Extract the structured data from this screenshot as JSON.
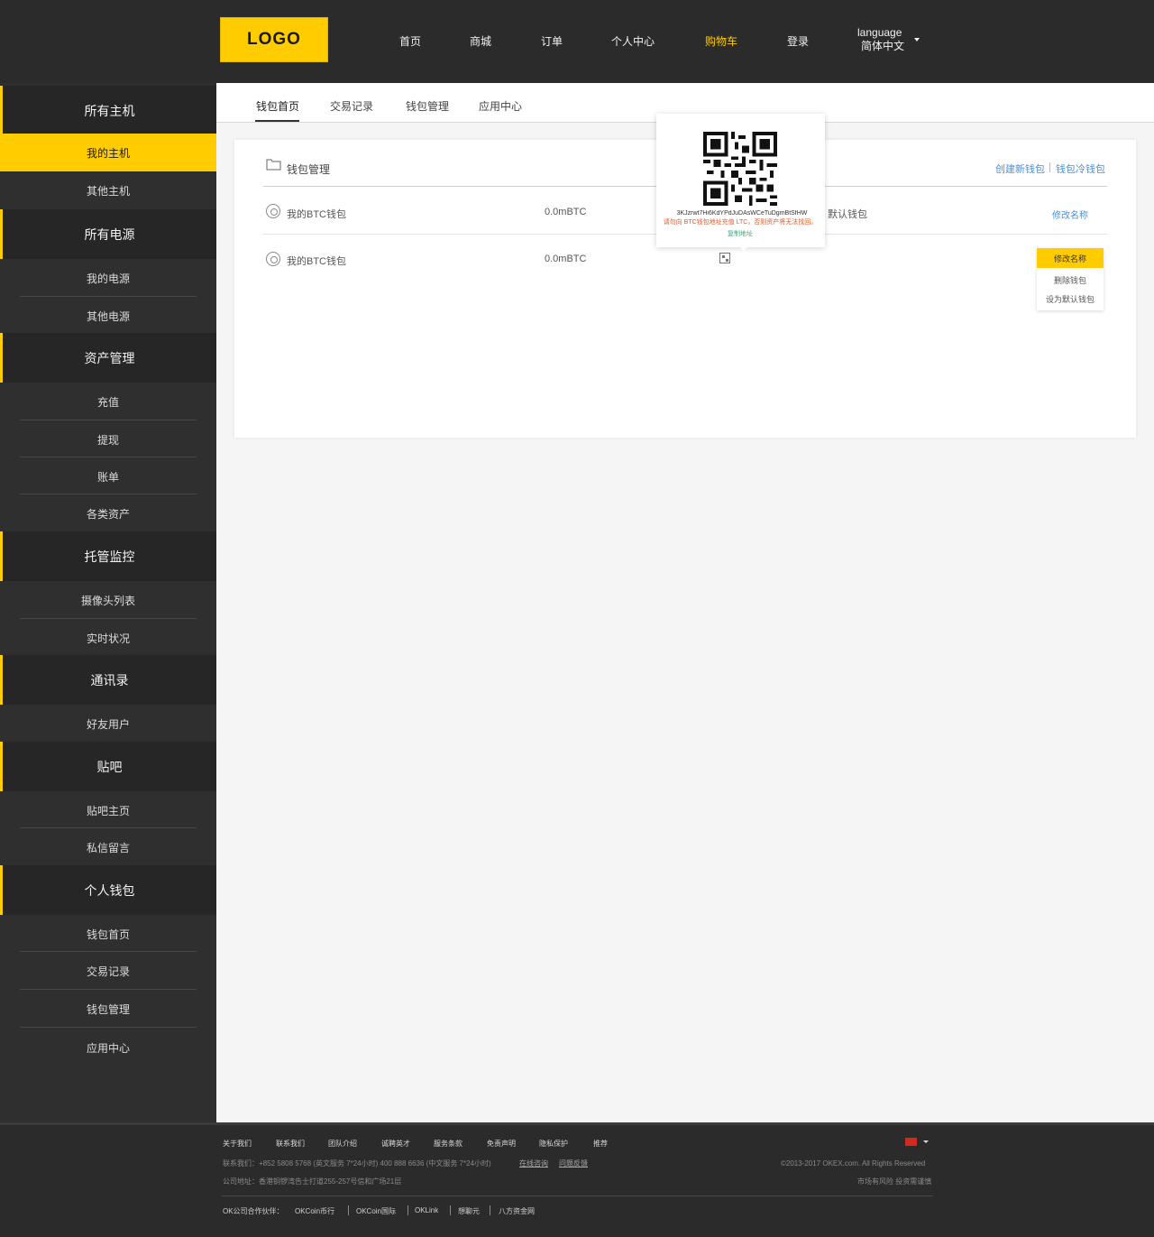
{
  "header": {
    "logo": "LOGO",
    "nav": [
      "首页",
      "商城",
      "订单",
      "个人中心",
      "购物车",
      "登录"
    ],
    "active_nav": "购物车",
    "language_label": "language",
    "language_value": "简体中文"
  },
  "sidebar": {
    "groups": [
      {
        "title": "所有主机",
        "items": [
          "我的主机",
          "其他主机"
        ]
      },
      {
        "title": "所有电源",
        "items": [
          "我的电源",
          "其他电源"
        ]
      },
      {
        "title": "资产管理",
        "items": [
          "充值",
          "提现",
          "账单",
          "各类资产"
        ]
      },
      {
        "title": "托管监控",
        "items": [
          "摄像头列表",
          "实时状况"
        ]
      },
      {
        "title": "通讯录",
        "items": [
          "好友用户"
        ]
      },
      {
        "title": "贴吧",
        "items": [
          "贴吧主页",
          "私信留言"
        ]
      },
      {
        "title": "个人钱包",
        "items": [
          "钱包首页",
          "交易记录",
          "钱包管理",
          "应用中心"
        ]
      }
    ],
    "active_item": "我的主机"
  },
  "tabs": [
    "钱包首页",
    "交易记录",
    "钱包管理",
    "应用中心"
  ],
  "active_tab": "钱包首页",
  "panel": {
    "title": "钱包管理",
    "create_link": "创建新钱包",
    "cold_link": "钱包冷钱包",
    "rows": [
      {
        "name": "我的BTC钱包",
        "amount": "0.0mBTC",
        "status": "默认钱包",
        "action": "修改名称"
      },
      {
        "name": "我的BTC钱包",
        "amount": "0.0mBTC",
        "status": "",
        "action": ""
      }
    ]
  },
  "dropdown": [
    "修改名称",
    "删除钱包",
    "设为默认钱包"
  ],
  "popup": {
    "address": "3KJzrwt7Hi6KdYPdJuDAsWCeTuDgmBtSfHW",
    "warning": "请勿向 BTC钱包地址充值 LTC，否则资产将无法找回。",
    "copy": "复制地址"
  },
  "footer": {
    "links": [
      "关于我们",
      "联系我们",
      "团队介绍",
      "诚聘英才",
      "服务条款",
      "免责声明",
      "隐私保护",
      "推荐"
    ],
    "contact": "联系我们：+852 5808 5768 (英文服务 7*24小时)    400 888 6636 (中文服务 7*24小时)",
    "contact_links": [
      "在线咨询",
      "问题反馈"
    ],
    "address": "公司地址：香港铜锣湾告士打道255-257号信和广场21层",
    "copyright": "©2013-2017 OKEX.com. All Rights Reserved",
    "risk": "市场有风险 投资需谨慎",
    "partners_label": "OK公司合作伙伴：",
    "partners": [
      "OKCoin币行",
      "OKCoin国际",
      "OKLink",
      "想聊元",
      "八方资金网"
    ]
  }
}
